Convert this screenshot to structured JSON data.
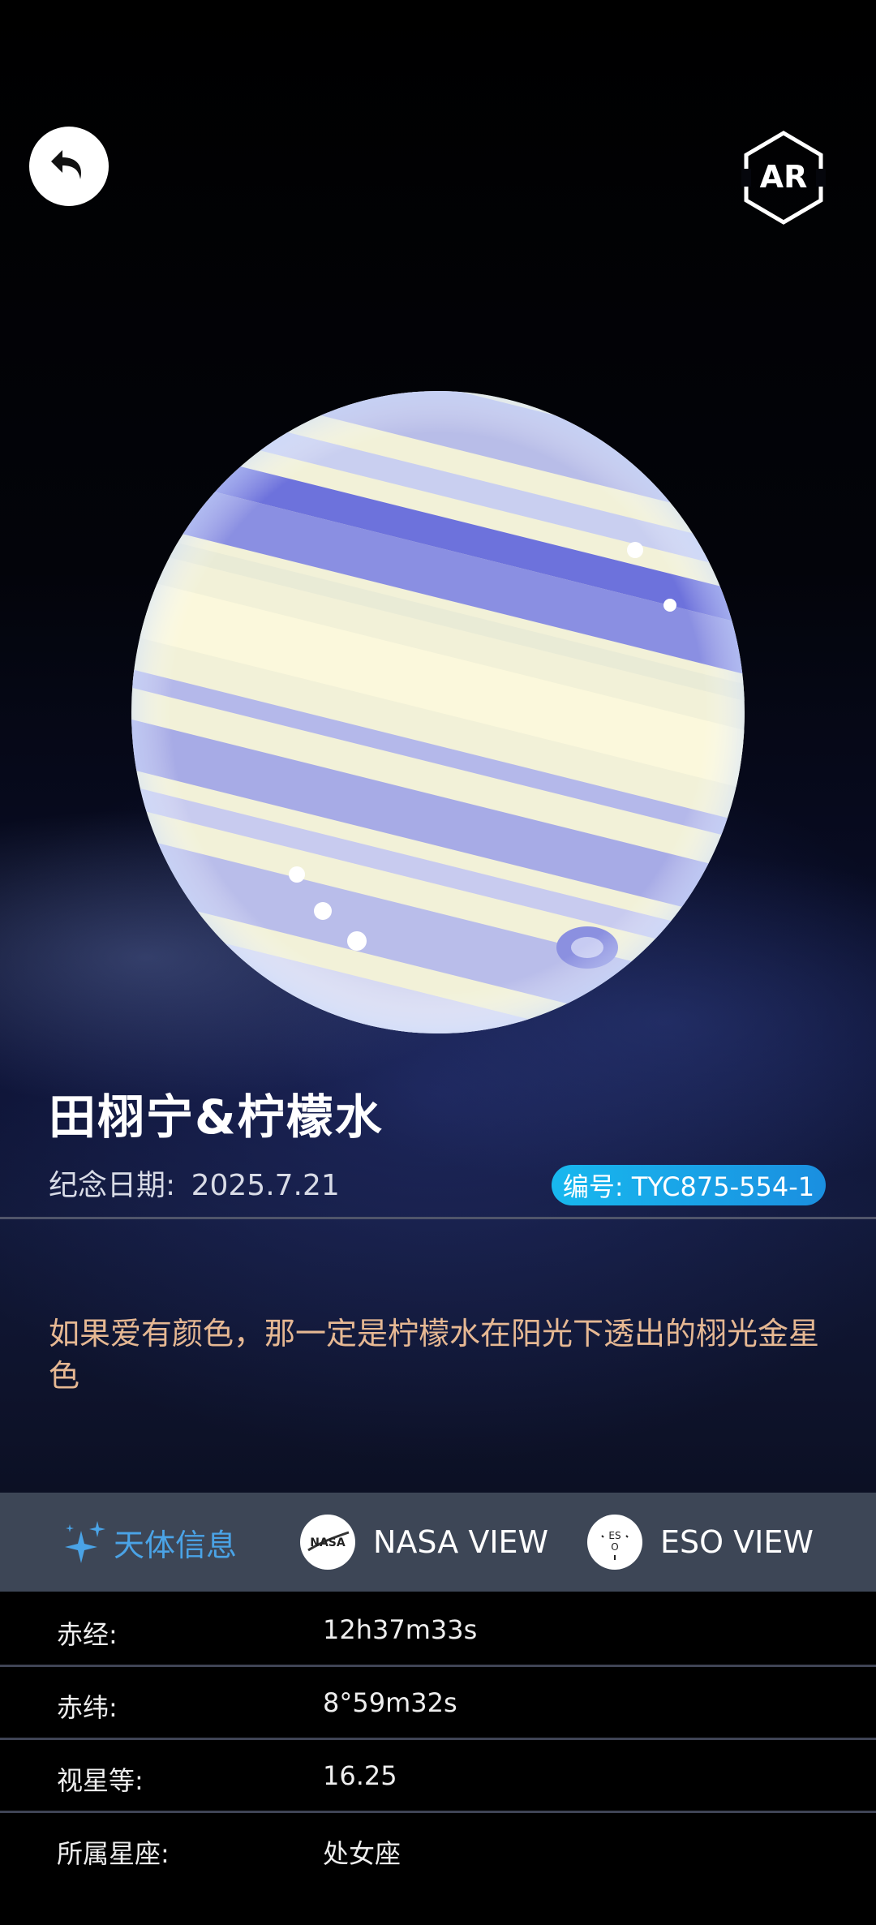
{
  "header": {
    "back_icon": "back-arrow-icon",
    "ar_label": "AR"
  },
  "star": {
    "name": "田栩宁&柠檬水",
    "date_label": "纪念日期:",
    "date_value": "2025.7.21",
    "id_badge": "编号: TYC875-554-1",
    "quote": "如果爱有颜色，那一定是柠檬水在阳光下透出的栩光金星色"
  },
  "tabs": [
    {
      "label": "天体信息",
      "icon": "sparkle-icon",
      "active": true
    },
    {
      "label": "NASA VIEW",
      "icon": "nasa-logo-icon",
      "active": false
    },
    {
      "label": "ESO VIEW",
      "icon": "eso-logo-icon",
      "active": false
    }
  ],
  "info": [
    {
      "label": "赤经:",
      "value": "12h37m33s"
    },
    {
      "label": "赤纬:",
      "value": "8°59m32s"
    },
    {
      "label": "视星等:",
      "value": "16.25"
    },
    {
      "label": "所属星座:",
      "value": "处女座"
    }
  ],
  "colors": {
    "badge": "#1aa8ea",
    "quote": "#e6b893",
    "active_tab": "#4aa3e6",
    "tabbar_bg": "#3d4656"
  }
}
